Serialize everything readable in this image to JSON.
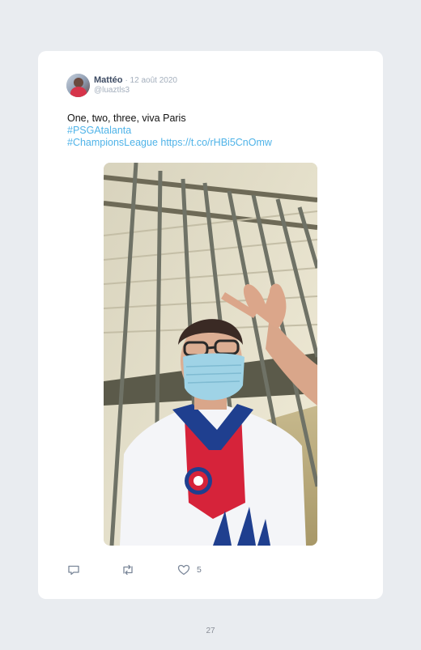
{
  "tweet": {
    "author": {
      "name": "Mattéo",
      "date": "· 12 août 2020",
      "handle": "@luaztls3"
    },
    "text": {
      "line1": "One, two, three, viva Paris",
      "hashtag1": "#PSGAtalanta",
      "hashtag2": "#ChampionsLeague",
      "url": "https://t.co/rHBi5CnOmw"
    },
    "photo": {
      "description_icon": "photo"
    },
    "actions": {
      "like_count": "5"
    }
  },
  "page": {
    "number": "27"
  },
  "colors": {
    "background": "#e9ecf0",
    "card": "#ffffff",
    "link": "#4fb3e8",
    "name": "#3d4b63",
    "muted": "#a4afbd"
  },
  "icons": {
    "reply": "reply-icon",
    "retweet": "retweet-icon",
    "like": "heart-icon"
  }
}
